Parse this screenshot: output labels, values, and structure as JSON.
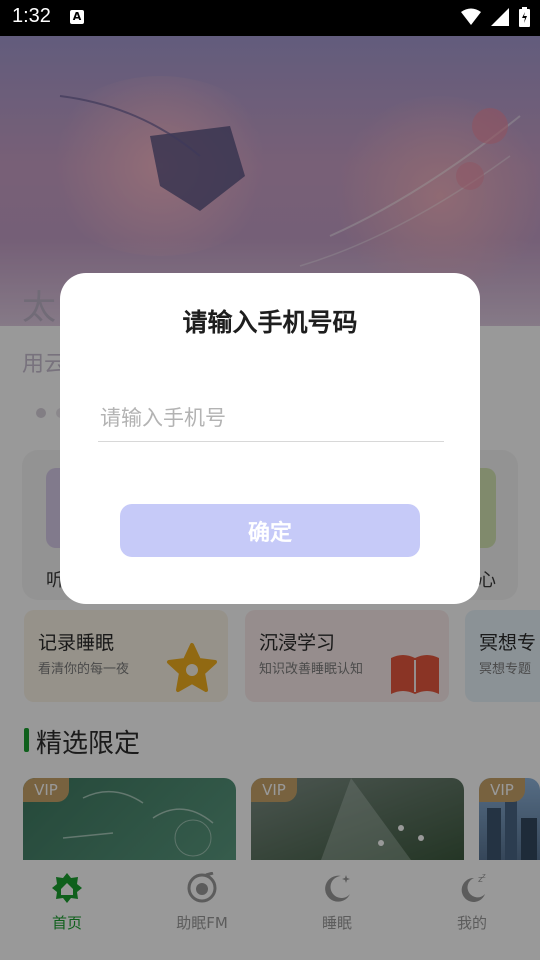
{
  "status_bar": {
    "time": "1:32",
    "a_icon": "A"
  },
  "hero": {
    "title": "太",
    "subtitle": "用云"
  },
  "feature_cards": {
    "left_label": "听",
    "right_label": "心"
  },
  "categories": [
    {
      "title": "记录睡眠",
      "subtitle": "看清你的每一夜"
    },
    {
      "title": "沉浸学习",
      "subtitle": "知识改善睡眠认知"
    },
    {
      "title": "冥想专",
      "subtitle": "冥想专题"
    }
  ],
  "section": {
    "title": "精选限定"
  },
  "thumbnails": [
    {
      "badge": "VIP"
    },
    {
      "badge": "VIP"
    },
    {
      "badge": "VIP"
    }
  ],
  "bottom_nav": [
    {
      "label": "首页",
      "icon": "home-icon",
      "active": true
    },
    {
      "label": "助眠FM",
      "icon": "radio-icon",
      "active": false
    },
    {
      "label": "睡眠",
      "icon": "moon-star-icon",
      "active": false
    },
    {
      "label": "我的",
      "icon": "moon-zzz-icon",
      "active": false
    }
  ],
  "dialog": {
    "title": "请输入手机号码",
    "input_placeholder": "请输入手机号",
    "input_value": "",
    "confirm_label": "确定"
  },
  "colors": {
    "accent_green": "#19a02f",
    "confirm_button": "#c6caf8",
    "vip_badge": "#c9a46a"
  }
}
